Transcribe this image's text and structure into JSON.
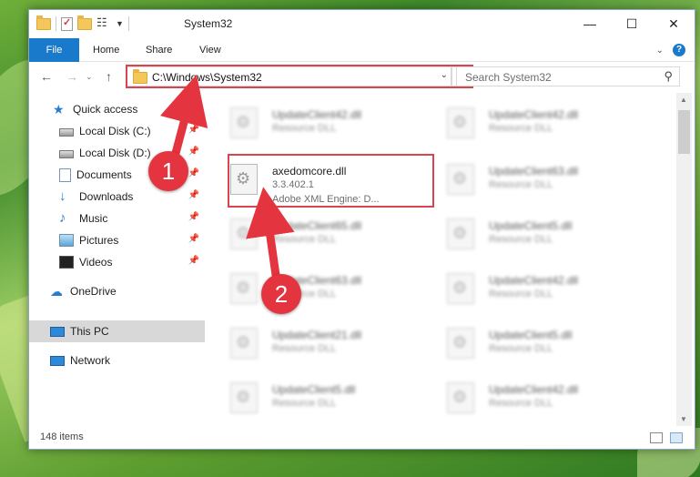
{
  "window": {
    "title": "System32",
    "controls": {
      "minimize": "—",
      "maximize": "☐",
      "close": "✕"
    }
  },
  "ribbon": {
    "tabs": [
      "File",
      "Home",
      "Share",
      "View"
    ],
    "help": "?",
    "collapse": "⌄"
  },
  "nav": {
    "back": "←",
    "forward": "→",
    "up": "↑",
    "address": "C:\\Windows\\System32",
    "address_dropdown": "⌄",
    "refresh": "↻",
    "search_placeholder": "Search System32",
    "search_icon": "⚲"
  },
  "sidebar": {
    "items": [
      {
        "label": "Quick access",
        "icon": "star-icon",
        "pinned": false
      },
      {
        "label": "Local Disk (C:)",
        "icon": "disk-icon",
        "pinned": true
      },
      {
        "label": "Local Disk (D:)",
        "icon": "disk-icon",
        "pinned": true
      },
      {
        "label": "Documents",
        "icon": "documents-icon",
        "pinned": true
      },
      {
        "label": "Downloads",
        "icon": "downloads-icon",
        "pinned": true
      },
      {
        "label": "Music",
        "icon": "music-icon",
        "pinned": true
      },
      {
        "label": "Pictures",
        "icon": "pictures-icon",
        "pinned": true
      },
      {
        "label": "Videos",
        "icon": "videos-icon",
        "pinned": true
      },
      {
        "label": "OneDrive",
        "icon": "onedrive-icon",
        "pinned": false
      },
      {
        "label": "This PC",
        "icon": "pc-icon",
        "pinned": false,
        "selected": true
      },
      {
        "label": "Network",
        "icon": "network-icon",
        "pinned": false
      }
    ],
    "pin_glyph": "📌"
  },
  "files": {
    "focused": {
      "name": "axedomcore.dll",
      "version": "3.3.402.1",
      "description": "Adobe XML Engine: D..."
    },
    "left_column": [
      {
        "name": "UpdateClient42.dll",
        "type": "Resource DLL"
      },
      {
        "name": "UpdateClient65.dll",
        "type": "Resource DLL"
      },
      {
        "name": "UpdateClient63.dll",
        "type": "Resource DLL"
      },
      {
        "name": "UpdateClient21.dll",
        "type": "Resource DLL"
      },
      {
        "name": "UpdateClient5.dll",
        "type": "Resource DLL"
      }
    ],
    "right_column": [
      {
        "name": "UpdateClient42.dll",
        "type": "Resource DLL"
      },
      {
        "name": "UpdateClient63.dll",
        "type": "Resource DLL"
      },
      {
        "name": "UpdateClient5.dll",
        "type": "Resource DLL"
      },
      {
        "name": "UpdateClient42.dll",
        "type": "Resource DLL"
      },
      {
        "name": "UpdateClient5.dll",
        "type": "Resource DLL"
      },
      {
        "name": "UpdateClient42.dll",
        "type": "Resource DLL"
      }
    ]
  },
  "status": {
    "count": "148 items"
  },
  "annotations": {
    "step1": "1",
    "step2": "2",
    "color": "#e3343f"
  }
}
